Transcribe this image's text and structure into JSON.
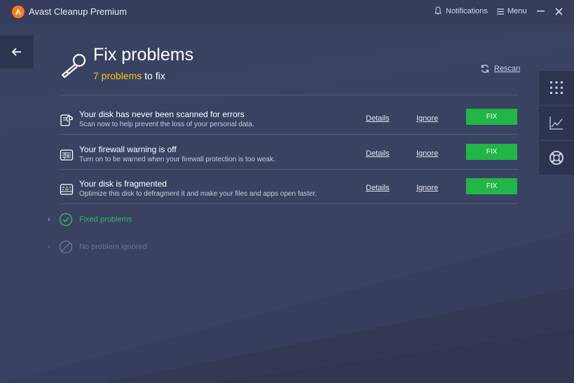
{
  "titlebar": {
    "app_title": "Avast Cleanup Premium",
    "notifications_label": "Notifications",
    "menu_label": "Menu"
  },
  "header": {
    "title": "Fix problems",
    "problem_count": "7 problems",
    "problem_suffix": " to fix",
    "rescan_label": "Rescan"
  },
  "problems": [
    {
      "title": "Your disk has never been scanned for errors",
      "description": "Scan now to help prevent the loss of your personal data.",
      "details_label": "Details",
      "ignore_label": "Ignore",
      "fix_label": "FIX",
      "icon": "disk-scan-icon"
    },
    {
      "title": "Your firewall warning is off",
      "description": "Turn on to be warned when your firewall protection is too weak.",
      "details_label": "Details",
      "ignore_label": "Ignore",
      "fix_label": "FIX",
      "icon": "firewall-icon"
    },
    {
      "title": "Your disk is fragmented",
      "description": "Optimize this disk to defragment it and make your files and apps open faster.",
      "details_label": "Details",
      "ignore_label": "Ignore",
      "fix_label": "FIX",
      "icon": "disk-icon"
    }
  ],
  "sections": {
    "fixed_label": "Fixed problems",
    "ignored_label": "No problem ignored"
  },
  "colors": {
    "background": "#3a4262",
    "accent_yellow": "#f5c518",
    "fix_green": "#22b547",
    "fixed_green": "#3fae6a",
    "muted": "#6a7190"
  }
}
